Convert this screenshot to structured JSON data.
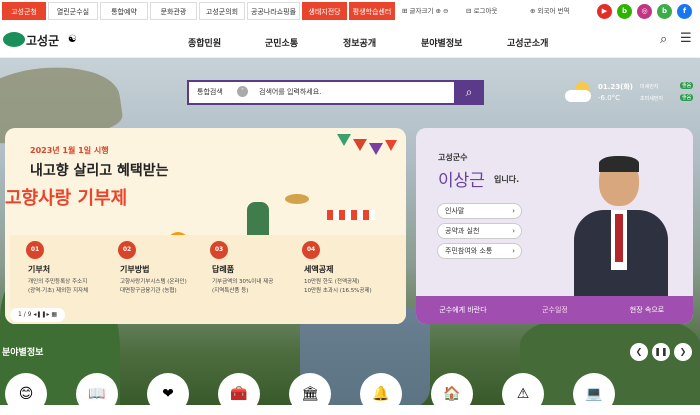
{
  "quick_tabs": [
    {
      "label": "고성군청",
      "bg": "#e8452c",
      "fg": "#fff"
    },
    {
      "label": "열린군수실",
      "bg": "#fff",
      "fg": "#333"
    },
    {
      "label": "통합예약",
      "bg": "#fff",
      "fg": "#333"
    },
    {
      "label": "문화관광",
      "bg": "#fff",
      "fg": "#333"
    },
    {
      "label": "고성군의회",
      "bg": "#fff",
      "fg": "#333"
    },
    {
      "label": "공공나라쇼핑몰",
      "bg": "#fff",
      "fg": "#333"
    },
    {
      "label": "생태지전당",
      "bg": "#e8452c",
      "fg": "#fff"
    },
    {
      "label": "평생학습센터",
      "bg": "#e8452c",
      "fg": "#fff"
    }
  ],
  "utility": {
    "font_size": "글자크기",
    "login": "로그아웃",
    "language": "외국어 번역"
  },
  "social": [
    {
      "name": "youtube-icon",
      "bg": "#e52d27",
      "glyph": "▶"
    },
    {
      "name": "blog-icon",
      "bg": "#2db400",
      "glyph": "b"
    },
    {
      "name": "instagram-icon",
      "bg": "#c13584",
      "glyph": "◎"
    },
    {
      "name": "band-icon",
      "bg": "#3aac48",
      "glyph": "b"
    },
    {
      "name": "facebook-icon",
      "bg": "#1877f2",
      "glyph": "f"
    }
  ],
  "logo": {
    "text": "고성군"
  },
  "gnb": [
    "종합민원",
    "군민소통",
    "정보공개",
    "분야별정보",
    "고성군소개"
  ],
  "search": {
    "category": "통합검색",
    "placeholder": "검색어를 입력하세요."
  },
  "weather": {
    "date": "01.23(화)",
    "sub": "미세먼지",
    "temp": "-6.0°C",
    "sub2": "초미세먼지",
    "badge1": "좋음",
    "badge2": "좋음"
  },
  "banner": {
    "date_line": "2023년 1월 1일 시행",
    "headline": "내고향 살리고 혜택받는",
    "title": "고향사랑 기부제",
    "pager": "1 / 9"
  },
  "steps": [
    {
      "num": "01",
      "title": "기부처",
      "desc": "개인의 주민등록상 주소지\n(광역·기초) 제외한 지자체"
    },
    {
      "num": "02",
      "title": "기부방법",
      "desc": "고향사랑기부시스템 (온라인)\n대면창구금융기관 (농협)"
    },
    {
      "num": "03",
      "title": "답례품",
      "desc": "기부금액의 30%이내 제공\n(지역특산품 등)"
    },
    {
      "num": "04",
      "title": "세액공제",
      "desc": "10만원 한도 (전액공제)\n10만원 초과시 (16.5%공제)"
    }
  ],
  "mayor": {
    "label": "고성군수",
    "name": "이상근",
    "suffix": "입니다.",
    "links": [
      "인사말",
      "공약과 실천",
      "주민참여와 소통"
    ],
    "nav": [
      "군수에게 바란다",
      "군수일정",
      "현장 속으로"
    ]
  },
  "section": {
    "title": "분야별정보"
  },
  "categories": [
    "😊",
    "📖",
    "❤",
    "🧰",
    "🏛",
    "🔔",
    "🏠",
    "⚠",
    "💻"
  ]
}
